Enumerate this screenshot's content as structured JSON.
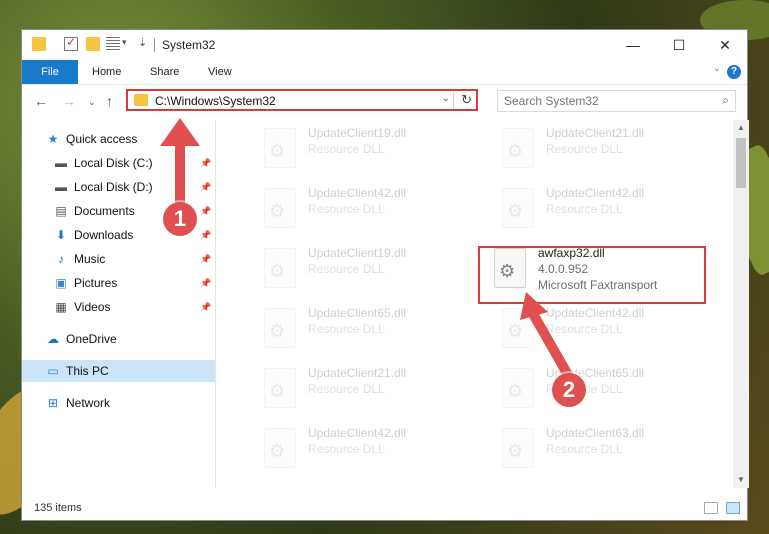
{
  "window": {
    "title": "System32",
    "controls": {
      "minimize": "—",
      "maximize": "☐",
      "close": "✕"
    }
  },
  "ribbon": {
    "tabs": [
      "File",
      "Home",
      "Share",
      "View"
    ],
    "help": "?"
  },
  "nav": {
    "address": "C:\\Windows\\System32",
    "search_placeholder": "Search System32"
  },
  "sidebar": {
    "items": [
      {
        "label": "Quick access",
        "icon": "star-icon",
        "glyph": "★",
        "color": "#2f7fd3",
        "pinned": false
      },
      {
        "label": "Local Disk (C:)",
        "icon": "drive-icon",
        "glyph": "▬",
        "color": "#555555",
        "pinned": true
      },
      {
        "label": "Local Disk (D:)",
        "icon": "drive-icon",
        "glyph": "▬",
        "color": "#555555",
        "pinned": true
      },
      {
        "label": "Documents",
        "icon": "document-icon",
        "glyph": "▤",
        "color": "#555555",
        "pinned": true
      },
      {
        "label": "Downloads",
        "icon": "download-icon",
        "glyph": "⬇",
        "color": "#1e72c8",
        "pinned": true
      },
      {
        "label": "Music",
        "icon": "music-icon",
        "glyph": "♪",
        "color": "#1e72c8",
        "pinned": true
      },
      {
        "label": "Pictures",
        "icon": "pictures-icon",
        "glyph": "▣",
        "color": "#3a86c8",
        "pinned": true
      },
      {
        "label": "Videos",
        "icon": "video-icon",
        "glyph": "▦",
        "color": "#444444",
        "pinned": true
      },
      {
        "label": "OneDrive",
        "icon": "cloud-icon",
        "glyph": "☁",
        "color": "#1e72c8",
        "pinned": false
      },
      {
        "label": "This PC",
        "icon": "computer-icon",
        "glyph": "▭",
        "color": "#2f7fd3",
        "pinned": false
      },
      {
        "label": "Network",
        "icon": "network-icon",
        "glyph": "⊞",
        "color": "#2f7fd3",
        "pinned": false
      }
    ]
  },
  "files": [
    {
      "name": "UpdateClient19.dll",
      "line1": "Resource DLL",
      "line2": ""
    },
    {
      "name": "UpdateClient21.dll",
      "line1": "Resource DLL",
      "line2": ""
    },
    {
      "name": "UpdateClient42.dll",
      "line1": "Resource DLL",
      "line2": ""
    },
    {
      "name": "UpdateClient42.dll",
      "line1": "Resource DLL",
      "line2": ""
    },
    {
      "name": "UpdateClient19.dll",
      "line1": "Resource DLL",
      "line2": ""
    },
    {
      "name": "awfaxp32.dll",
      "line1": "4.0.0.952",
      "line2": "Microsoft Faxtransport"
    },
    {
      "name": "UpdateClient65.dll",
      "line1": "Resource DLL",
      "line2": ""
    },
    {
      "name": "UpdateClient42.dll",
      "line1": "Resource DLL",
      "line2": ""
    },
    {
      "name": "UpdateClient21.dll",
      "line1": "Resource DLL",
      "line2": ""
    },
    {
      "name": "UpdateClient65.dll",
      "line1": "Resource DLL",
      "line2": ""
    },
    {
      "name": "UpdateClient42.dll",
      "line1": "Resource DLL",
      "line2": ""
    },
    {
      "name": "UpdateClient63.dll",
      "line1": "Resource DLL",
      "line2": ""
    }
  ],
  "status": {
    "count": "135 items"
  },
  "annotations": {
    "step1": "1",
    "step2": "2",
    "color": "#e05050"
  }
}
